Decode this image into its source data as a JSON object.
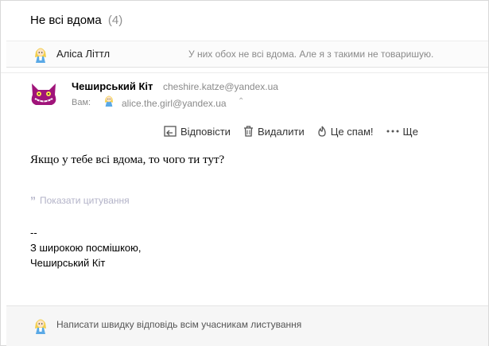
{
  "thread": {
    "title": "Не всі вдома",
    "count": "(4)"
  },
  "collapsed_message": {
    "sender": "Аліса Літтл",
    "snippet": "У них обох не всі вдома. Але я з такими не товаришую."
  },
  "message": {
    "from_name": "Чеширський Кіт",
    "from_email": "cheshire.katze@yandex.ua",
    "to_label": "Вам:",
    "to_email": "alice.the.girl@yandex.ua",
    "body": "Якщо у тебе всі вдома, то чого ти тут?",
    "show_quotes": "Показати цитування",
    "signature": [
      "--",
      "З широкою посмішкою,",
      "Чеширський Кіт"
    ]
  },
  "toolbar": {
    "reply": "Відповісти",
    "delete": "Видалити",
    "spam": "Це спам!",
    "more": "Ще"
  },
  "quick_reply": {
    "placeholder": "Написати швидку відповідь всім учасникам листування"
  },
  "colors": {
    "cat_avatar": "#a0147a",
    "link_muted": "#b3b3c8",
    "muted_text": "#8a8a8a"
  }
}
